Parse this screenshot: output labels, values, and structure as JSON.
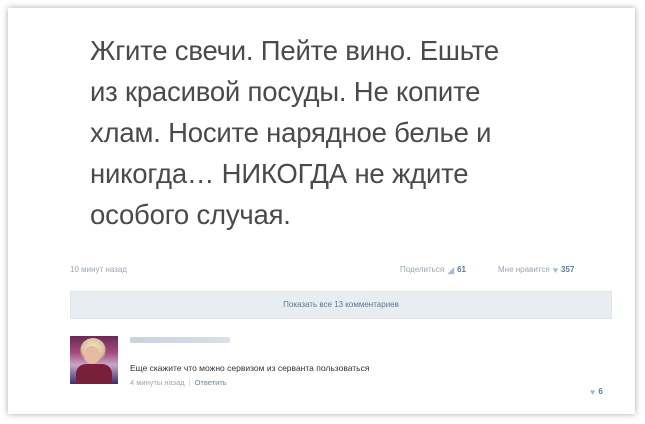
{
  "post": {
    "lines": [
      "Жгите свечи. Пейте вино. Ешьте",
      "из красивой посуды. Не копите",
      "хлам. Носите нарядное белье и",
      "никогда… НИКОГДА не ждите",
      "особого случая."
    ],
    "timestamp": "10 минут назад",
    "share_label": "Поделиться",
    "share_count": "61",
    "like_label": "Мне нравится",
    "like_count": "357",
    "share_icon": "megaphone-icon",
    "like_icon": "heart-icon"
  },
  "comments_button": {
    "label": "Показать все 13 комментариев"
  },
  "comment": {
    "text": "Еще скажите что можно сервизом из серванта пользоваться",
    "timestamp": "4 минуты назад",
    "reply_label": "Ответить",
    "like_count": "6"
  },
  "colors": {
    "post_text": "#4a4a4a",
    "meta_text": "#9aa6b3",
    "link_blue": "#5a7aa0",
    "button_bg": "#e8edf2"
  }
}
